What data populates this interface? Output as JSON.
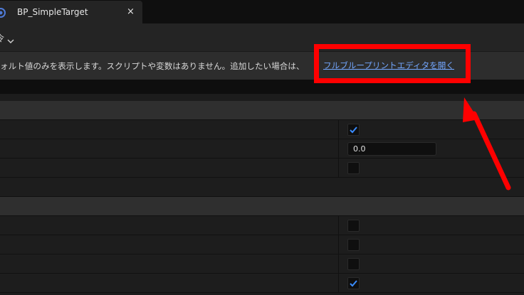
{
  "tab": {
    "title": "BP_SimpleTarget",
    "close": "×",
    "icon": "blueprint-icon"
  },
  "toolbar": {
    "button_label": "令",
    "dropdown_icon": "chevron-down-icon"
  },
  "notice": {
    "message": "ォルト値のみを表示します。スクリプトや変数はありません。追加したい場合は、",
    "link": "フルブループリントエディタを開く"
  },
  "rows": [
    {
      "kind": "category"
    },
    {
      "kind": "property",
      "value_type": "checkbox",
      "checked": true
    },
    {
      "kind": "property",
      "value_type": "number",
      "value": "0.0"
    },
    {
      "kind": "property",
      "value_type": "checkbox",
      "checked": false
    },
    {
      "kind": "property",
      "value_type": "empty"
    },
    {
      "kind": "category"
    },
    {
      "kind": "property",
      "value_type": "checkbox",
      "checked": false
    },
    {
      "kind": "property",
      "value_type": "checkbox",
      "checked": false
    },
    {
      "kind": "property",
      "value_type": "checkbox",
      "checked": false
    },
    {
      "kind": "property",
      "value_type": "checkbox",
      "checked": true
    }
  ],
  "colors": {
    "annotation": "#ff0000",
    "link": "#73a7ff",
    "check": "#3a8cff"
  }
}
